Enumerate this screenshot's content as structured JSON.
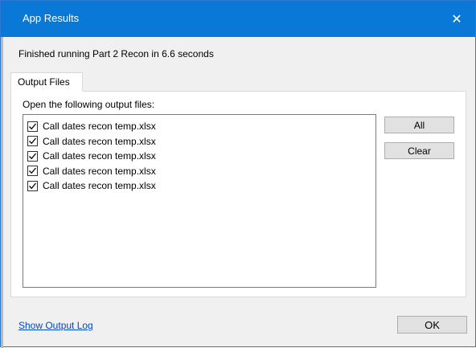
{
  "window": {
    "title": "App Results",
    "close_glyph": "✕",
    "accent_color": "#0a78d7"
  },
  "status": {
    "message": "Finished running Part 2 Recon in 6.6 seconds"
  },
  "tabs": [
    {
      "label": "Output Files",
      "active": true
    }
  ],
  "output_files": {
    "prompt": "Open the following output files:",
    "items": [
      {
        "label": "Call dates recon temp.xlsx",
        "checked": true
      },
      {
        "label": "Call dates recon temp.xlsx",
        "checked": true
      },
      {
        "label": "Call dates recon temp.xlsx",
        "checked": true
      },
      {
        "label": "Call dates recon temp.xlsx",
        "checked": true
      },
      {
        "label": "Call dates recon temp.xlsx",
        "checked": true
      }
    ],
    "all_label": "All",
    "clear_label": "Clear"
  },
  "footer": {
    "link_label": "Show Output Log",
    "ok_label": "OK"
  }
}
